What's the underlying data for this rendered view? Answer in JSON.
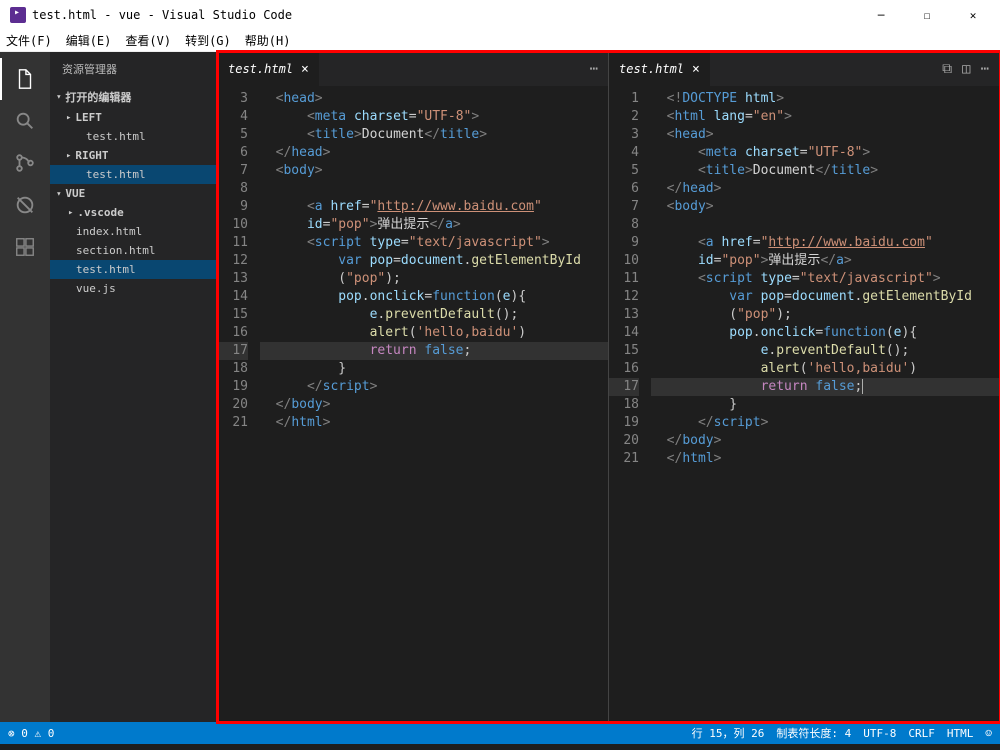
{
  "title": "test.html - vue - Visual Studio Code",
  "menu": {
    "file": "文件(F)",
    "edit": "编辑(E)",
    "view": "查看(V)",
    "goto": "转到(G)",
    "help": "帮助(H)"
  },
  "sidebar": {
    "title": "资源管理器",
    "open_editors": "打开的编辑器",
    "left": "LEFT",
    "right": "RIGHT",
    "project": "VUE",
    "files": {
      "f0": "test.html",
      "f1": "test.html",
      "f2": ".vscode",
      "f3": "index.html",
      "f4": "section.html",
      "f5": "test.html",
      "f6": "vue.js"
    }
  },
  "tabs": {
    "left": "test.html",
    "right": "test.html"
  },
  "codeLeft": {
    "start": 3,
    "lines": [
      {
        "html": "  <span class='t-brk'>&lt;</span><span class='t-tag'>head</span><span class='t-brk'>&gt;</span>"
      },
      {
        "html": "      <span class='t-brk'>&lt;</span><span class='t-tag'>meta</span> <span class='t-attr'>charset</span>=<span class='t-str'>\"UTF-8\"</span><span class='t-brk'>&gt;</span>"
      },
      {
        "html": "      <span class='t-brk'>&lt;</span><span class='t-tag'>title</span><span class='t-brk'>&gt;</span><span class='t-txt'>Document</span><span class='t-brk'>&lt;/</span><span class='t-tag'>title</span><span class='t-brk'>&gt;</span>"
      },
      {
        "html": "  <span class='t-brk'>&lt;/</span><span class='t-tag'>head</span><span class='t-brk'>&gt;</span>"
      },
      {
        "html": "  <span class='t-brk'>&lt;</span><span class='t-tag'>body</span><span class='t-brk'>&gt;</span>"
      },
      {
        "html": ""
      },
      {
        "html": "      <span class='t-brk'>&lt;</span><span class='t-tag'>a</span> <span class='t-attr'>href</span>=<span class='t-str'>\"</span><span class='t-url'>http://www.baidu.com</span><span class='t-str'>\"</span>"
      },
      {
        "html": "      <span class='t-attr'>id</span>=<span class='t-str'>\"pop\"</span><span class='t-brk'>&gt;</span><span class='t-txt'>弹出提示</span><span class='t-brk'>&lt;/</span><span class='t-tag'>a</span><span class='t-brk'>&gt;</span>"
      },
      {
        "html": "      <span class='t-brk'>&lt;</span><span class='t-tag'>script</span> <span class='t-attr'>type</span>=<span class='t-str'>\"text/javascript\"</span><span class='t-brk'>&gt;</span>"
      },
      {
        "html": "          <span class='t-kw'>var</span> <span class='t-var'>pop</span>=<span class='t-var'>document</span>.<span class='t-fn'>getElementById</span>"
      },
      {
        "html": "          (<span class='t-str'>\"pop\"</span>);"
      },
      {
        "html": "          <span class='t-var'>pop</span>.<span class='t-var'>onclick</span>=<span class='t-kw'>function</span>(<span class='t-var'>e</span>){"
      },
      {
        "html": "              <span class='t-var'>e</span>.<span class='t-fn'>preventDefault</span>();"
      },
      {
        "html": "              <span class='t-fn'>alert</span>(<span class='t-str'>'hello,baidu'</span>)"
      },
      {
        "hl": true,
        "html": "              <span class='t-kw2'>return</span> <span class='t-kw'>false</span>;"
      },
      {
        "html": "          }"
      },
      {
        "html": "      <span class='t-brk'>&lt;/</span><span class='t-tag'>script</span><span class='t-brk'>&gt;</span>"
      },
      {
        "html": "  <span class='t-brk'>&lt;/</span><span class='t-tag'>body</span><span class='t-brk'>&gt;</span>"
      },
      {
        "html": "  <span class='t-brk'>&lt;/</span><span class='t-tag'>html</span><span class='t-brk'>&gt;</span>"
      }
    ]
  },
  "codeRight": {
    "start": 1,
    "lines": [
      {
        "html": "  <span class='t-brk'>&lt;!</span><span class='t-tag'>DOCTYPE</span> <span class='t-attr'>html</span><span class='t-brk'>&gt;</span>"
      },
      {
        "html": "  <span class='t-brk'>&lt;</span><span class='t-tag'>html</span> <span class='t-attr'>lang</span>=<span class='t-str'>\"en\"</span><span class='t-brk'>&gt;</span>"
      },
      {
        "html": "  <span class='t-brk'>&lt;</span><span class='t-tag'>head</span><span class='t-brk'>&gt;</span>"
      },
      {
        "html": "      <span class='t-brk'>&lt;</span><span class='t-tag'>meta</span> <span class='t-attr'>charset</span>=<span class='t-str'>\"UTF-8\"</span><span class='t-brk'>&gt;</span>"
      },
      {
        "html": "      <span class='t-brk'>&lt;</span><span class='t-tag'>title</span><span class='t-brk'>&gt;</span><span class='t-txt'>Document</span><span class='t-brk'>&lt;/</span><span class='t-tag'>title</span><span class='t-brk'>&gt;</span>"
      },
      {
        "html": "  <span class='t-brk'>&lt;/</span><span class='t-tag'>head</span><span class='t-brk'>&gt;</span>"
      },
      {
        "html": "  <span class='t-brk'>&lt;</span><span class='t-tag'>body</span><span class='t-brk'>&gt;</span>"
      },
      {
        "html": ""
      },
      {
        "html": "      <span class='t-brk'>&lt;</span><span class='t-tag'>a</span> <span class='t-attr'>href</span>=<span class='t-str'>\"</span><span class='t-url'>http://www.baidu.com</span><span class='t-str'>\"</span>"
      },
      {
        "html": "      <span class='t-attr'>id</span>=<span class='t-str'>\"pop\"</span><span class='t-brk'>&gt;</span><span class='t-txt'>弹出提示</span><span class='t-brk'>&lt;/</span><span class='t-tag'>a</span><span class='t-brk'>&gt;</span>"
      },
      {
        "html": "      <span class='t-brk'>&lt;</span><span class='t-tag'>script</span> <span class='t-attr'>type</span>=<span class='t-str'>\"text/javascript\"</span><span class='t-brk'>&gt;</span>"
      },
      {
        "html": "          <span class='t-kw'>var</span> <span class='t-var'>pop</span>=<span class='t-var'>document</span>.<span class='t-fn'>getElementById</span>"
      },
      {
        "html": "          (<span class='t-str'>\"pop\"</span>);"
      },
      {
        "html": "          <span class='t-var'>pop</span>.<span class='t-var'>onclick</span>=<span class='t-kw'>function</span>(<span class='t-var'>e</span>){"
      },
      {
        "html": "              <span class='t-var'>e</span>.<span class='t-fn'>preventDefault</span>();"
      },
      {
        "html": "              <span class='t-fn'>alert</span>(<span class='t-str'>'hello,baidu'</span>)"
      },
      {
        "hl": true,
        "html": "              <span class='t-kw2'>return</span> <span class='t-kw'>false</span>;<span style='border-left:1px solid #aeafad'></span>"
      },
      {
        "html": "          }"
      },
      {
        "html": "      <span class='t-brk'>&lt;/</span><span class='t-tag'>script</span><span class='t-brk'>&gt;</span>"
      },
      {
        "html": "  <span class='t-brk'>&lt;/</span><span class='t-tag'>body</span><span class='t-brk'>&gt;</span>"
      },
      {
        "html": "  <span class='t-brk'>&lt;/</span><span class='t-tag'>html</span><span class='t-brk'>&gt;</span>"
      }
    ]
  },
  "status": {
    "errors": "⊗ 0 ⚠ 0",
    "pos": "行 15，列 26",
    "tab": "制表符长度: 4",
    "enc": "UTF-8",
    "eol": "CRLF",
    "lang": "HTML",
    "smile": "☺"
  }
}
